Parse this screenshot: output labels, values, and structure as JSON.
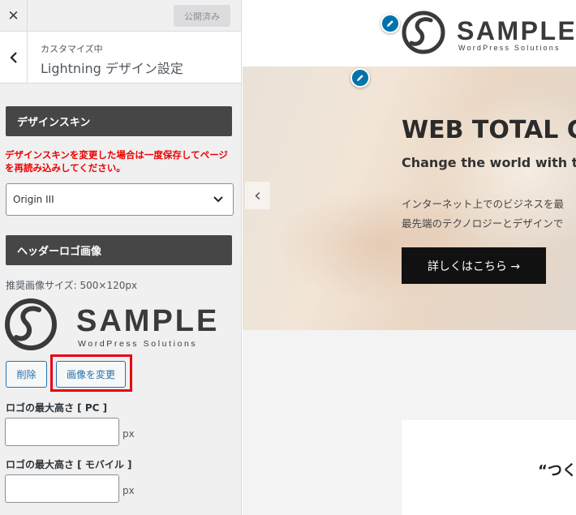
{
  "sidebar": {
    "close_symbol": "✕",
    "publish_label": "公開済み",
    "back_symbol": "‹",
    "customizing_label": "カスタマイズ中",
    "panel_title": "Lightning デザイン設定",
    "design_skin": {
      "heading": "デザインスキン",
      "warning": "デザインスキンを変更した場合は一度保存してページを再読み込みしてください。",
      "selected": "Origin III"
    },
    "header_logo": {
      "heading": "ヘッダーロゴ画像",
      "recommended_size": "推奨画像サイズ: 500×120px",
      "delete_label": "削除",
      "change_label": "画像を変更"
    },
    "logo_max_pc": {
      "label": "ロゴの最大高さ [ PC ]",
      "value": "",
      "unit": "px"
    },
    "logo_max_mobile": {
      "label": "ロゴの最大高さ [ モバイル ]",
      "value": "",
      "unit": "px"
    }
  },
  "logo": {
    "name": "SAMPLE",
    "tagline": "WordPress Solutions"
  },
  "preview": {
    "hero": {
      "title": "WEB TOTAL C",
      "subtitle": "Change the world with th",
      "line1": "インターネット上でのビジネスを最",
      "line2": "最先端のテクノロジーとデザインで",
      "button_label": "詳しくはこちら →",
      "arrow_symbol": "‹"
    },
    "section_text": "“つく"
  },
  "colors": {
    "accent_blue": "#2271b1",
    "edit_pin": "#0073aa",
    "highlight_red": "#e60012",
    "warning_red": "#e00000",
    "heading_bar": "#464646"
  },
  "icons": [
    "close-icon",
    "chevron-left-icon",
    "chevron-down-icon",
    "pencil-icon",
    "sample-logo"
  ]
}
